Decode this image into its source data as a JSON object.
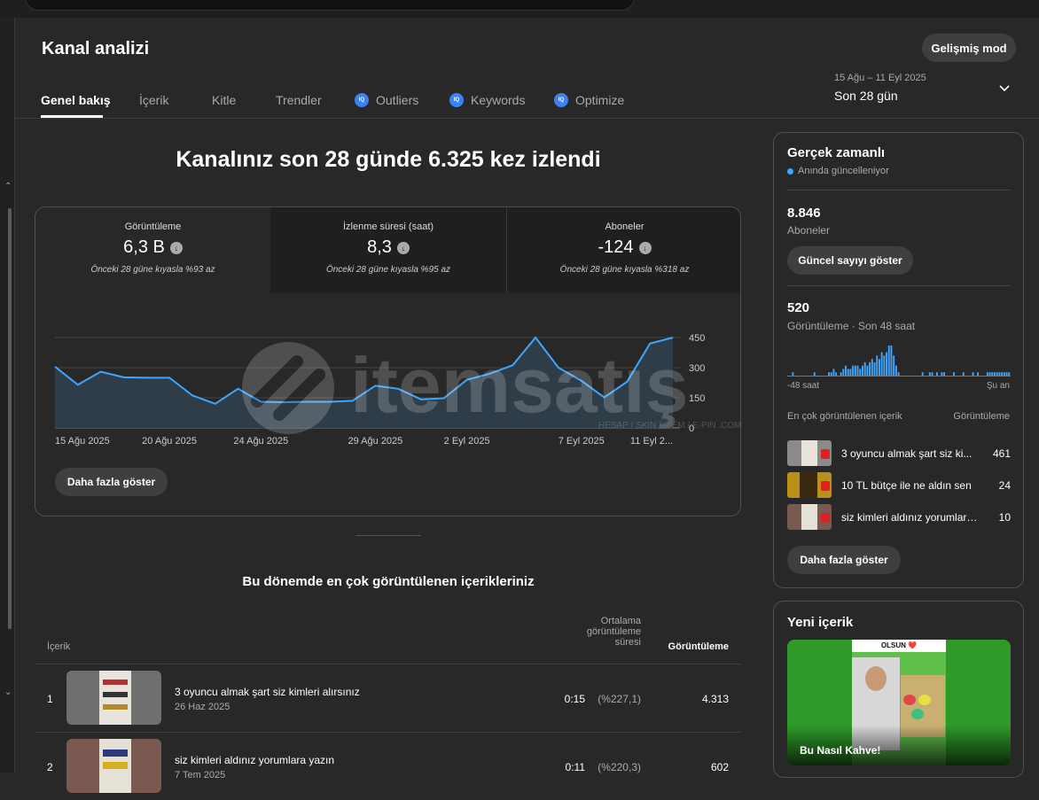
{
  "header": {
    "title": "Kanal analizi",
    "advanced_mode": "Gelişmiş mod",
    "tabs": [
      {
        "label": "Genel bakış"
      },
      {
        "label": "İçerik"
      },
      {
        "label": "Kitle"
      },
      {
        "label": "Trendler"
      },
      {
        "label": "Outliers",
        "badge": "IQ"
      },
      {
        "label": "Keywords",
        "badge": "IQ"
      },
      {
        "label": "Optimize",
        "badge": "IQ"
      }
    ],
    "date_range": "15 Ağu – 11 Eyl 2025",
    "date_label": "Son 28 gün"
  },
  "overview": {
    "headline": "Kanalınız son 28 günde 6.325 kez izlendi",
    "metrics": [
      {
        "label": "Görüntüleme",
        "value": "6,3 B",
        "compare": "Önceki 28 güne kıyasla %93 az"
      },
      {
        "label": "İzlenme süresi (saat)",
        "value": "8,3",
        "compare": "Önceki 28 güne kıyasla %95 az"
      },
      {
        "label": "Aboneler",
        "value": "-124",
        "compare": "Önceki 28 güne kıyasla %318 az"
      }
    ],
    "more_button": "Daha fazla göster"
  },
  "chart_data": {
    "type": "area",
    "x": [
      "15 Ağu 2025",
      "16 Ağu",
      "17 Ağu",
      "18 Ağu",
      "19 Ağu",
      "20 Ağu 2025",
      "21 Ağu",
      "22 Ağu",
      "23 Ağu",
      "24 Ağu 2025",
      "25 Ağu",
      "26 Ağu",
      "27 Ağu",
      "28 Ağu",
      "29 Ağu 2025",
      "30 Ağu",
      "31 Ağu",
      "1 Eyl",
      "2 Eyl 2025",
      "3 Eyl",
      "4 Eyl",
      "5 Eyl",
      "6 Eyl",
      "7 Eyl 2025",
      "8 Eyl",
      "9 Eyl",
      "10 Eyl",
      "11 Eyl 2025"
    ],
    "x_tick_labels": [
      "15 Ağu 2025",
      "20 Ağu 2025",
      "24 Ağu 2025",
      "29 Ağu 2025",
      "2 Eyl 2025",
      "7 Eyl 2025",
      "11 Eyl 2..."
    ],
    "x_tick_index": [
      0,
      5,
      9,
      14,
      18,
      23,
      27
    ],
    "values": [
      305,
      215,
      280,
      252,
      250,
      250,
      162,
      120,
      195,
      130,
      128,
      130,
      130,
      135,
      210,
      195,
      142,
      148,
      240,
      270,
      312,
      450,
      300,
      235,
      152,
      230,
      420,
      450
    ],
    "y_ticks": [
      "450",
      "300",
      "150",
      "0"
    ],
    "ylim": [
      0,
      450
    ],
    "colors": {
      "line": "#3ea6ff",
      "fill": "#2f3d48"
    }
  },
  "top_content": {
    "title": "Bu dönemde en çok görüntülenen içerikleriniz",
    "headers": {
      "content": "İçerik",
      "avg_line1": "Ortalama",
      "avg_line2": "görüntüleme",
      "avg_line3": "süresi",
      "views": "Görüntüleme"
    },
    "rows": [
      {
        "rank": "1",
        "title": "3 oyuncu almak şart siz kimleri alırsınız",
        "date": "26 Haz 2025",
        "avg": "0:15",
        "pct": "(%227,1)",
        "views": "4.313"
      },
      {
        "rank": "2",
        "title": "siz kimleri aldınız yorumlara yazın",
        "date": "7 Tem 2025",
        "avg": "0:11",
        "pct": "(%220,3)",
        "views": "602"
      }
    ]
  },
  "realtime": {
    "title": "Gerçek zamanlı",
    "live": "Anında güncelleniyor",
    "subscribers_value": "8.846",
    "subscribers_label": "Aboneler",
    "show_count_button": "Güncel sayıyı göster",
    "views_value": "520",
    "views_label": "Görüntüleme · Son 48 saat",
    "axis_left": "-48 saat",
    "axis_right": "Şu an",
    "bars": [
      0,
      0,
      1,
      0,
      0,
      0,
      0,
      0,
      0,
      0,
      0,
      1,
      0,
      0,
      0,
      0,
      0,
      1,
      1,
      2,
      1,
      0,
      1,
      2,
      3,
      2,
      2,
      3,
      3,
      3,
      2,
      3,
      4,
      3,
      4,
      5,
      4,
      6,
      5,
      7,
      6,
      7,
      9,
      9,
      6,
      3,
      1,
      0,
      0,
      0,
      0,
      0,
      0,
      0,
      0,
      0,
      1,
      0,
      0,
      1,
      1,
      0,
      1,
      0,
      1,
      1,
      0,
      0,
      0,
      1,
      0,
      0,
      0,
      1,
      0,
      0,
      0,
      1,
      0,
      1,
      0,
      0,
      0,
      1,
      1,
      1,
      1,
      1,
      1,
      1,
      1,
      1,
      1
    ],
    "top_header_left": "En çok görüntülenen içerik",
    "top_header_right": "Görüntüleme",
    "top_items": [
      {
        "title": "3 oyuncu almak şart siz ki...",
        "views": "461"
      },
      {
        "title": "10 TL bütçe ile ne aldın sen",
        "views": "24"
      },
      {
        "title": "siz kimleri aldınız yorumlara ...",
        "views": "10"
      }
    ],
    "more_button": "Daha fazla göster"
  },
  "new_content": {
    "title": "Yeni içerik",
    "video_title": "Bu Nasıl Kahve!",
    "overlay_text": "OLSUN ❤️"
  },
  "watermark": {
    "brand": "itemsatış",
    "tagline": "HESAP / SKIN / ITEM / E-PIN .COM"
  }
}
